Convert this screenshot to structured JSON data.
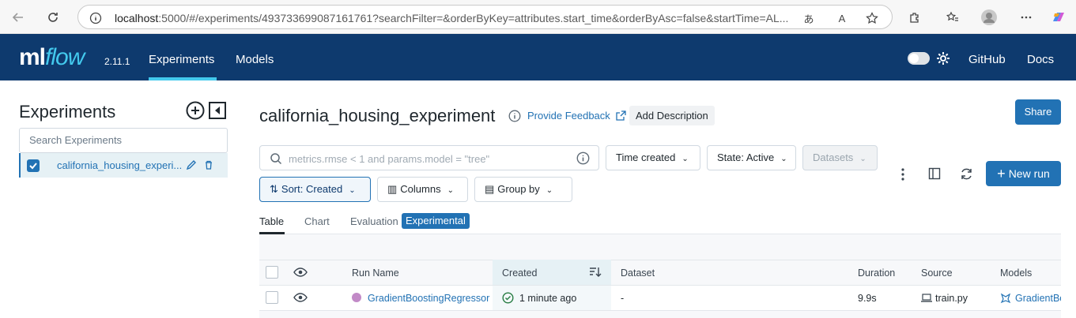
{
  "browser": {
    "url_host": "localhost",
    "url_rest": ":5000/#/experiments/493733699087161761?searchFilter=&orderByKey=attributes.start_time&orderByAsc=false&startTime=AL..."
  },
  "header": {
    "logo_ml": "ml",
    "logo_flow": "flow",
    "version": "2.11.1",
    "nav": [
      "Experiments",
      "Models"
    ],
    "github": "GitHub",
    "docs": "Docs"
  },
  "sidebar": {
    "title": "Experiments",
    "search_placeholder": "Search Experiments",
    "items": [
      {
        "label": "california_housing_experi..."
      }
    ]
  },
  "main": {
    "title": "california_housing_experiment",
    "feedback": "Provide Feedback",
    "add_description": "Add Description",
    "share": "Share",
    "search_placeholder": "metrics.rmse < 1 and params.model = \"tree\"",
    "filters": {
      "time": "Time created",
      "state": "State: Active",
      "datasets": "Datasets"
    },
    "sort": "Sort: Created",
    "columns": "Columns",
    "group_by": "Group by",
    "new_run": "New run",
    "tabs": [
      "Table",
      "Chart",
      "Evaluation"
    ],
    "experimental_badge": "Experimental"
  },
  "table": {
    "headers": {
      "run_name": "Run Name",
      "created": "Created",
      "dataset": "Dataset",
      "duration": "Duration",
      "source": "Source",
      "models": "Models"
    },
    "rows": [
      {
        "run_name": "GradientBoostingRegressor",
        "created": "1 minute ago",
        "dataset": "-",
        "duration": "9.9s",
        "source": "train.py",
        "models": "GradientBo"
      }
    ]
  },
  "colors": {
    "header_bg": "#0e3a6e",
    "accent": "#2272b4",
    "logo_flow": "#43c9ed",
    "run_dot": "#c28ac7",
    "success": "#277c43"
  }
}
